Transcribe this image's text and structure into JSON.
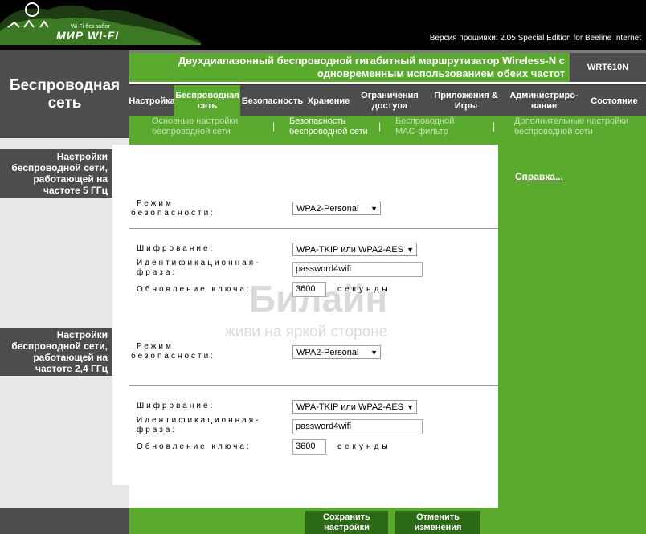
{
  "header": {
    "logo_tagline": "Wi-Fi без забот",
    "logo_name": "МИР WI-FI",
    "firmware": "Версия прошивки: 2.05 Special Edition for Beeline Internet"
  },
  "section_title": "Беспроводная сеть",
  "title": {
    "line1": "Двухдиапазонный беспроводной гигабитный маршрутизатор Wireless-N с",
    "line2": "одновременным использованием обеих частот"
  },
  "model": "WRT610N",
  "tabs": [
    {
      "label": "Настройка"
    },
    {
      "label": "Беспроводная сеть"
    },
    {
      "label": "Безопасность"
    },
    {
      "label": "Хранение"
    },
    {
      "label": "Ограничения доступа"
    },
    {
      "label": "Приложения & Игры"
    },
    {
      "label": "Администриро-вание"
    },
    {
      "label": "Состояние"
    }
  ],
  "subtabs": [
    {
      "label": "Основные настройки беспроводной сети"
    },
    {
      "label": "Безопасность беспроводной сети"
    },
    {
      "label": "Беспроводной MAC-фильтр"
    },
    {
      "label": "Дополнительные настройки беспроводной сети"
    }
  ],
  "help_link": "Справка...",
  "sections": [
    {
      "label": "Настройки беспроводной сети, работающей на частоте 5 ГГц",
      "mode_label_1": "Режим",
      "mode_label_2": "безопасности:",
      "mode_value": "WPA2-Personal",
      "enc_label": "Шифрование:",
      "enc_value": "WPA-TKIP или WPA2-AES",
      "phrase_label_1": "Идентификационная-",
      "phrase_label_2": "фраза:",
      "phrase_value": "password4wifi",
      "renew_label": "Обновление ключа:",
      "renew_value": "3600",
      "renew_unit": "секунды"
    },
    {
      "label": "Настройки беспроводной сети, работающей на частоте 2,4 ГГц",
      "mode_label_1": "Режим",
      "mode_label_2": "безопасности:",
      "mode_value": "WPA2-Personal",
      "enc_label": "Шифрование:",
      "enc_value": "WPA-TKIP или WPA2-AES",
      "phrase_label_1": "Идентификационная-",
      "phrase_label_2": "фраза:",
      "phrase_value": "password4wifi",
      "renew_label": "Обновление ключа:",
      "renew_value": "3600",
      "renew_unit": "секунды"
    }
  ],
  "watermark": {
    "brand": "Билайн",
    "slogan": "живи на яркой стороне"
  },
  "buttons": {
    "save": "Сохранить настройки",
    "cancel": "Отменить изменения"
  },
  "colors": {
    "green": "#5aaa2e",
    "dark_gray": "#4d4d4d",
    "dark_green": "#2d6a18"
  }
}
